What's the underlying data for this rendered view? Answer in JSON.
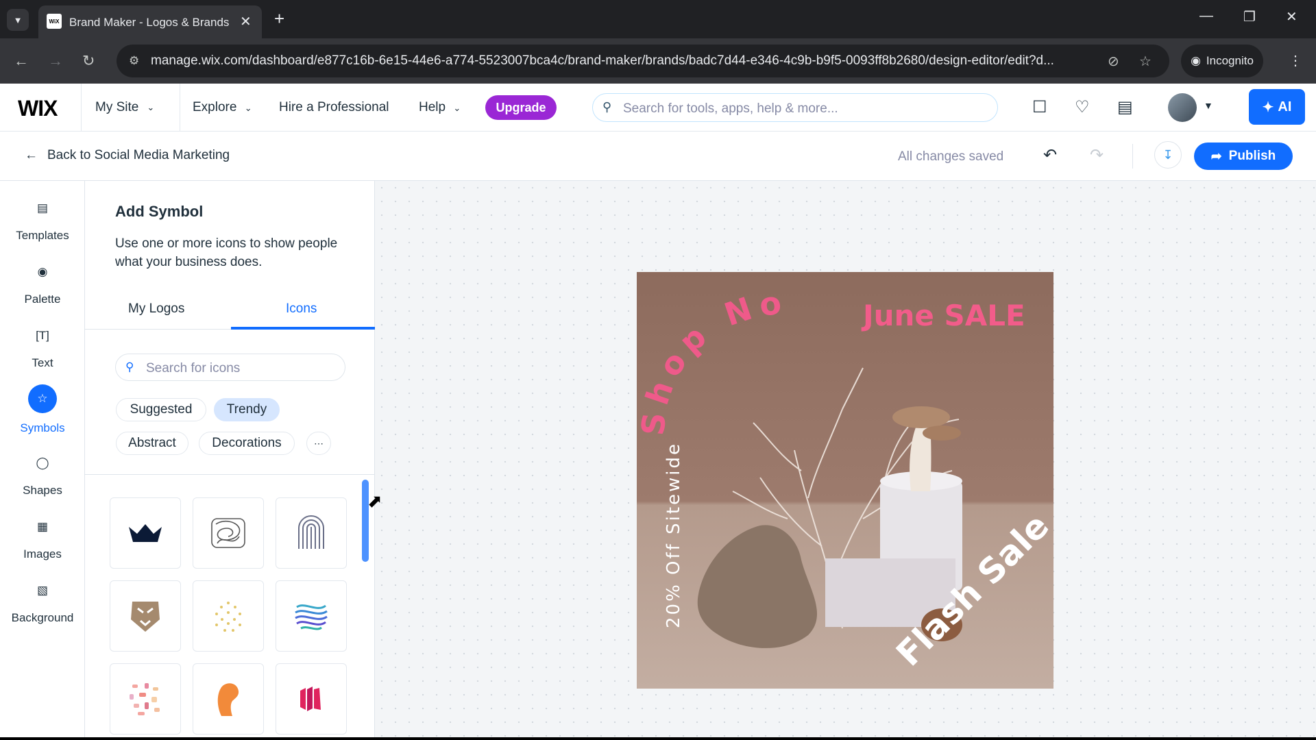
{
  "browser": {
    "tab_title": "Brand Maker - Logos & Brands",
    "favicon_text": "WiX",
    "url": "manage.wix.com/dashboard/e877c16b-6e15-44e6-a774-5523007bca4c/brand-maker/brands/badc7d44-e346-4c9b-b9f5-0093ff8b2680/design-editor/edit?d...",
    "incognito_label": "Incognito"
  },
  "wix_bar": {
    "logo": "WIX",
    "site_selector": "My Site",
    "nav": [
      "Explore",
      "Hire a Professional",
      "Help"
    ],
    "upgrade_label": "Upgrade",
    "search_placeholder": "Search for tools, apps, help & more...",
    "ai_label": "AI"
  },
  "editor_header": {
    "back_label": "Back to Social Media Marketing",
    "status": "All changes saved",
    "publish_label": "Publish"
  },
  "rail": {
    "items": [
      {
        "label": "Templates",
        "icon": "templates-icon",
        "active": false
      },
      {
        "label": "Palette",
        "icon": "palette-icon",
        "active": false
      },
      {
        "label": "Text",
        "icon": "text-icon",
        "active": false
      },
      {
        "label": "Symbols",
        "icon": "star-icon",
        "active": true
      },
      {
        "label": "Shapes",
        "icon": "shapes-icon",
        "active": false
      },
      {
        "label": "Images",
        "icon": "image-icon",
        "active": false
      },
      {
        "label": "Background",
        "icon": "background-icon",
        "active": false
      }
    ]
  },
  "panel": {
    "title": "Add Symbol",
    "description": "Use one or more icons to show people what your business does.",
    "tabs": [
      "My Logos",
      "Icons"
    ],
    "active_tab": "Icons",
    "search_placeholder": "Search for icons",
    "chips": [
      "Suggested",
      "Trendy",
      "Abstract",
      "Decorations"
    ],
    "selected_chip": "Trendy",
    "icons": [
      "crown-icon",
      "scribble-icon",
      "fingerprint-icon",
      "lion-icon",
      "dots-icon",
      "wave-globe-icon",
      "confetti-icon",
      "flame-icon",
      "stripes-icon"
    ]
  },
  "design": {
    "shop_now": "Shop Now",
    "june_sale": "June SALE",
    "off_sitewide": "20% Off Sitewide",
    "flash_sale": "Flash Sale"
  },
  "colors": {
    "accent": "#116dff",
    "upgrade": "#9a27d5",
    "sale_pink": "#f25c8a",
    "design_bg": "#8b6a5c"
  }
}
